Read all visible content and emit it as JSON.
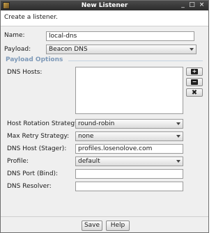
{
  "window": {
    "title": "New Listener",
    "controls": {
      "minimize": "_",
      "maximize": "□",
      "close": "×"
    }
  },
  "header": {
    "text": "Create a listener."
  },
  "form": {
    "name": {
      "label": "Name:",
      "value": "local-dns"
    },
    "payload": {
      "label": "Payload:",
      "value": "Beacon DNS"
    }
  },
  "payload_options": {
    "title": "Payload Options",
    "dns_hosts": {
      "label": "DNS Hosts:",
      "items": []
    },
    "host_rotation": {
      "label": "Host Rotation Strategy:",
      "value": "round-robin"
    },
    "max_retry": {
      "label": "Max Retry Strategy:",
      "value": "none"
    },
    "dns_host_stager": {
      "label": "DNS Host (Stager):",
      "value": "profiles.losenolove.com"
    },
    "profile": {
      "label": "Profile:",
      "value": "default"
    },
    "dns_port_bind": {
      "label": "DNS Port (Bind):",
      "value": ""
    },
    "dns_resolver": {
      "label": "DNS Resolver:",
      "value": ""
    }
  },
  "list_buttons": {
    "add": "+",
    "remove": "−",
    "clear": "✖"
  },
  "buttons": {
    "save": "Save",
    "help": "Help"
  }
}
